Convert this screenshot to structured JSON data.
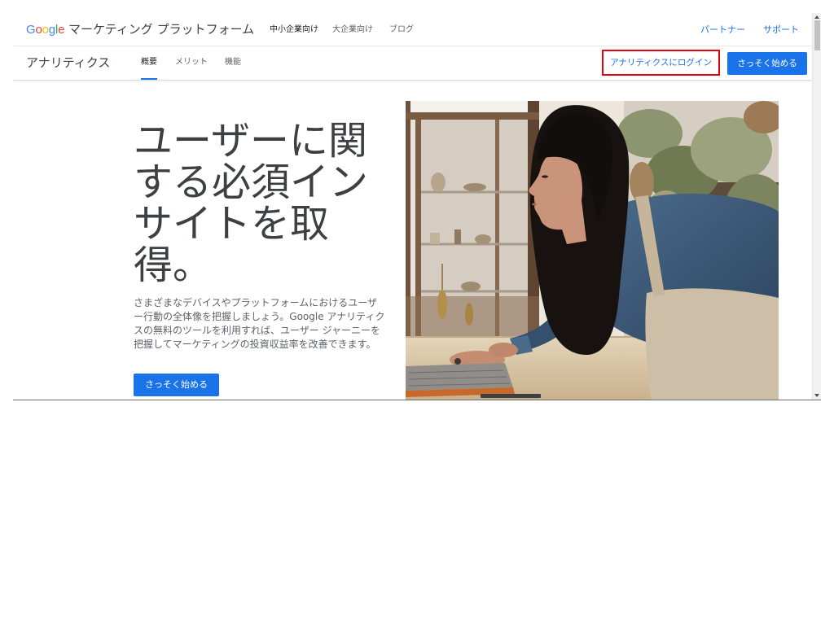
{
  "header": {
    "logo": {
      "text": "Google",
      "letter_colors": [
        "#4285F4",
        "#EA4335",
        "#FBBC05",
        "#4285F4",
        "#34A853",
        "#EA4335"
      ]
    },
    "product_name": "マーケティング プラットフォーム",
    "nav": [
      {
        "label": "中小企業向け",
        "active": true
      },
      {
        "label": "大企業向け",
        "active": false
      },
      {
        "label": "ブログ",
        "active": false
      }
    ],
    "utility_links": [
      {
        "label": "パートナー"
      },
      {
        "label": "サポート"
      }
    ]
  },
  "subnav": {
    "title": "アナリティクス",
    "tabs": [
      {
        "label": "概要",
        "active": true
      },
      {
        "label": "メリット",
        "active": false
      },
      {
        "label": "機能",
        "active": false
      }
    ],
    "login_label": "アナリティクスにログイン",
    "cta_label": "さっそく始める"
  },
  "hero": {
    "title": "ユーザーに関する必須インサイトを取得。",
    "description": "さまざまなデバイスやプラットフォームにおけるユーザー行動の全体像を把握しましょう。Google アナリティクスの無料のツールを利用すれば、ユーザー ジャーニーを把握してマーケティングの投資収益率を改善できます。",
    "cta_label": "さっそく始める"
  },
  "scrollbar": {
    "scroll_position": 0,
    "visible_fraction": 0.08,
    "up_icon": "scroll-up-arrow-icon",
    "down_icon": "scroll-down-arrow-icon"
  },
  "theme": {
    "accent": "#1a73e8",
    "highlight": "#e8000b"
  }
}
